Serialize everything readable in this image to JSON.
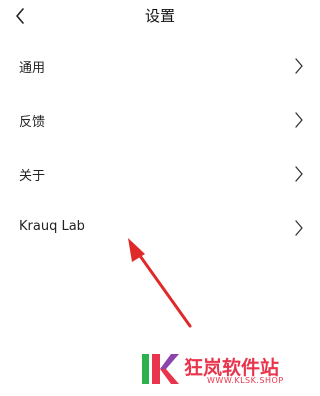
{
  "header": {
    "title": "设置",
    "back_icon": "chevron-left-icon"
  },
  "menu": {
    "items": [
      {
        "label": "通用",
        "icon": "chevron-right-icon"
      },
      {
        "label": "反馈",
        "icon": "chevron-right-icon"
      },
      {
        "label": "关于",
        "icon": "chevron-right-icon"
      },
      {
        "label": "Krauq Lab",
        "icon": "chevron-right-icon"
      }
    ]
  },
  "annotation": {
    "icon": "red-arrow-icon",
    "color": "#e02a2a"
  },
  "watermark": {
    "name": "狂岚软件站",
    "url": "WWW.KLSK.SHOP",
    "colors": {
      "text": "#e8354d",
      "green": "#2bb24c",
      "pink": "#e8354d",
      "purple": "#8b44ac"
    }
  }
}
